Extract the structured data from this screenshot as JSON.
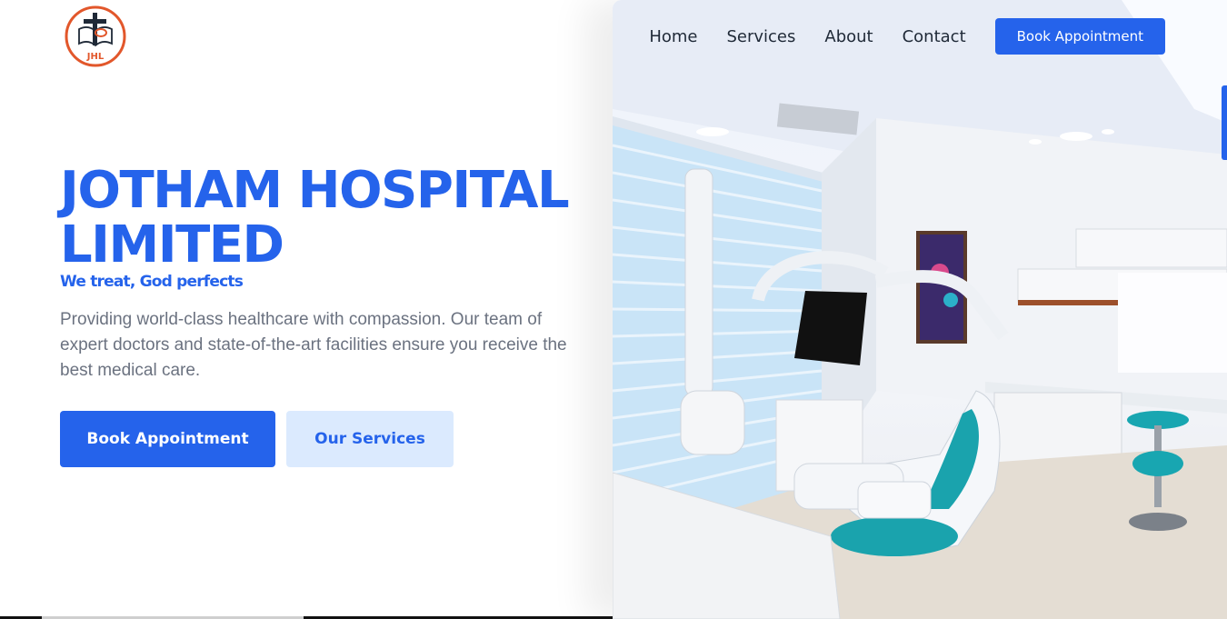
{
  "brand": {
    "logo_text": "JHL",
    "accent_color": "#2563eb",
    "logo_color": "#e2572b"
  },
  "nav": {
    "links": [
      "Home",
      "Services",
      "About",
      "Contact"
    ],
    "cta_label": "Book Appointment"
  },
  "hero": {
    "title_line1": "JOTHAM HOSPITAL",
    "title_line2": "LIMITED",
    "tagline": "We treat, God perfects",
    "description": "Providing world-class healthcare with compassion. Our team of expert doctors and state-of-the-art facilities ensure you receive the best medical care.",
    "primary_button": "Book Appointment",
    "secondary_button": "Our Services"
  },
  "image": {
    "subject": "dental-clinic-room-photo"
  }
}
